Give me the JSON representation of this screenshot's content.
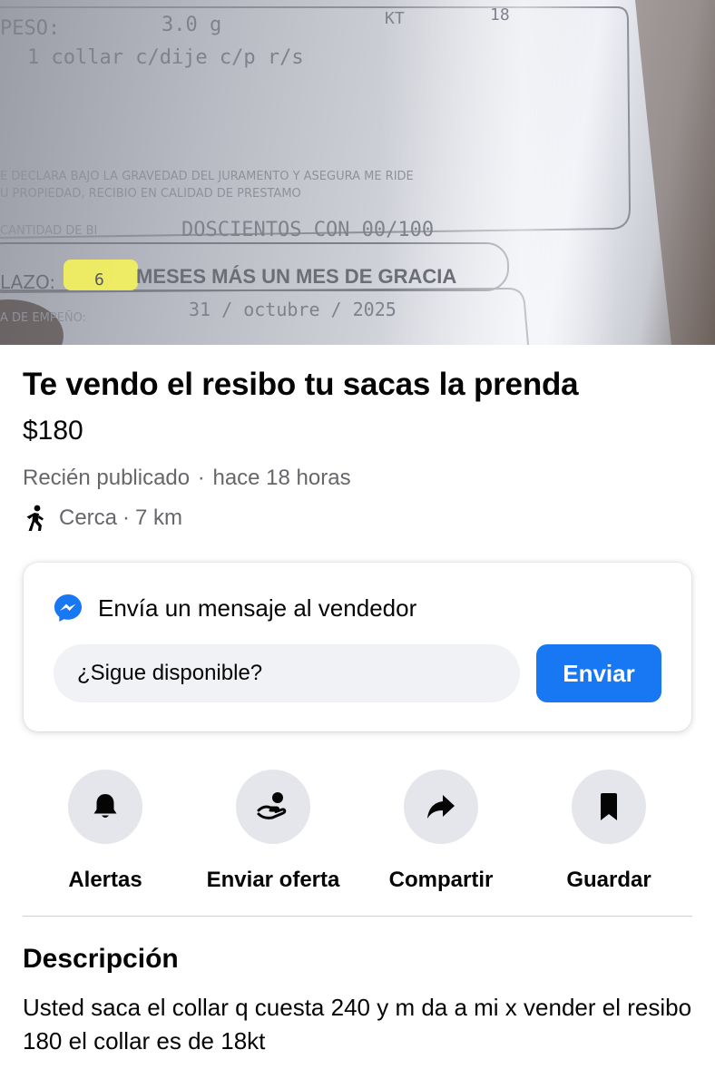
{
  "photo": {
    "receipt_lines": {
      "peso": "PESO:",
      "weight": "3.0 g",
      "kt": "KT",
      "kt_value": "18",
      "item": "1 collar c/dije c/p r/s",
      "declaration_1": "E DECLARA BAJO LA GRAVEDAD DEL JURAMENTO Y ASEGURA ME RIDE",
      "declaration_2": "U PROPIEDAD, RECIBIO EN CALIDAD DE PRESTAMO",
      "cantidad_label": "CANTIDAD DE BI",
      "cantidad_value": "DOSCIENTOS CON 00/100",
      "plazo_label": "LAZO:",
      "plazo_number": "6",
      "plazo_text": "MESES MÁS UN MES DE GRACIA",
      "empeno_label": "A DE EMPEÑO:",
      "empeno_date": "31 / octubre / 2025"
    }
  },
  "listing": {
    "title": "Te vendo el resibo tu sacas la prenda",
    "price": "$180",
    "status": "Recién publicado",
    "separator": "·",
    "posted": "hace 18 horas",
    "distance_label": "Cerca",
    "distance": "7 km"
  },
  "message_card": {
    "title": "Envía un mensaje al vendedor",
    "input_value": "¿Sigue disponible?",
    "send_label": "Enviar"
  },
  "actions": [
    {
      "label": "Alertas",
      "icon": "bell-icon"
    },
    {
      "label": "Enviar oferta",
      "icon": "offer-hand-icon"
    },
    {
      "label": "Compartir",
      "icon": "share-arrow-icon"
    },
    {
      "label": "Guardar",
      "icon": "bookmark-icon"
    }
  ],
  "description": {
    "heading": "Descripción",
    "text": "Usted saca el collar q cuesta 240 y m da a mi x vender el resibo 180 el collar es de 18kt"
  },
  "colors": {
    "accent": "#1877f2",
    "secondary_text": "#65676b",
    "action_circle": "#e4e6eb"
  }
}
